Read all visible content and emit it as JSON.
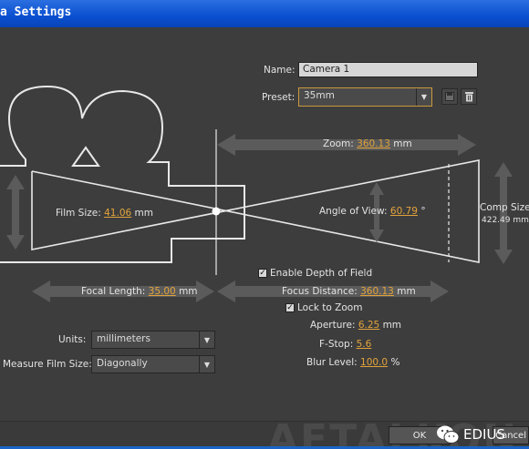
{
  "window": {
    "title": "a Settings"
  },
  "name": {
    "label": "Name:",
    "value": "Camera 1"
  },
  "preset": {
    "label": "Preset:",
    "value": "35mm"
  },
  "zoom": {
    "label": "Zoom:",
    "value": "360.13",
    "unit": "mm"
  },
  "comp_size": {
    "label": "Comp Size",
    "value": "422.49 mm"
  },
  "film_size": {
    "label": "Film Size:",
    "value": "41.06",
    "unit": "mm"
  },
  "angle_of_view": {
    "label": "Angle of View:",
    "value": "60.79",
    "unit": "°"
  },
  "enable_dof": {
    "label": "Enable Depth of Field",
    "checked": true
  },
  "focal_length": {
    "label": "Focal Length:",
    "value": "35.00",
    "unit": "mm"
  },
  "focus_distance": {
    "label": "Focus Distance:",
    "value": "360.13",
    "unit": "mm"
  },
  "lock_to_zoom": {
    "label": "Lock to Zoom",
    "checked": true
  },
  "aperture": {
    "label": "Aperture:",
    "value": "6.25",
    "unit": "mm"
  },
  "fstop": {
    "label": "F-Stop:",
    "value": "5.6"
  },
  "blur_level": {
    "label": "Blur Level:",
    "value": "100.0",
    "unit": "%"
  },
  "units": {
    "label": "Units:",
    "value": "millimeters"
  },
  "measure_film_size": {
    "label": "Measure Film Size:",
    "value": "Diagonally"
  },
  "buttons": {
    "ok": "OK",
    "cancel": "Cancel"
  },
  "watermark": {
    "text": "AETALKON",
    "brand": "EDIUS"
  },
  "icons": {
    "save": "save-icon",
    "delete": "trash-icon",
    "dropdown": "chevron-down-icon"
  },
  "colors": {
    "value_accent": "#e2a33c",
    "title_bar": "#0a4fd0",
    "diagram_line": "#e8e8e8"
  }
}
